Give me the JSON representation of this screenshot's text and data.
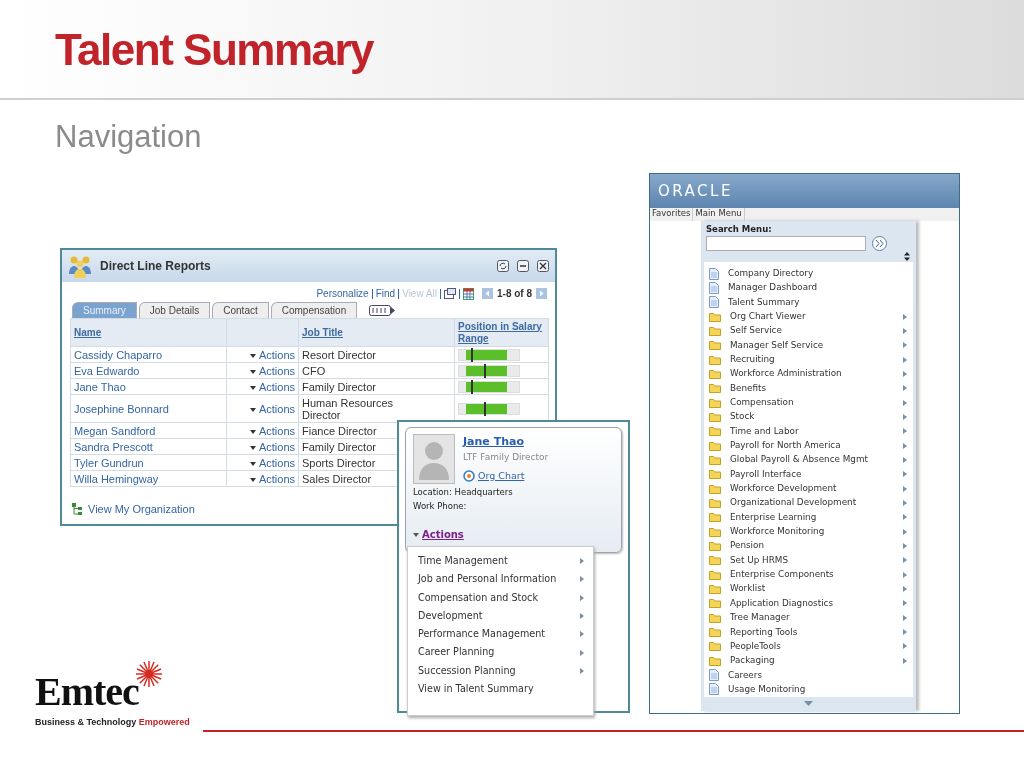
{
  "slide": {
    "title": "Talent Summary",
    "subtitle": "Navigation"
  },
  "direct_reports": {
    "title": "Direct Line Reports",
    "toolbar": [
      {
        "label": "Personalize",
        "disabled": false
      },
      {
        "label": "Find",
        "disabled": false
      },
      {
        "label": "View All",
        "disabled": true
      }
    ],
    "range": "1-8 of 8",
    "tabs": [
      {
        "label": "Summary",
        "selected": true
      },
      {
        "label": "Job Details",
        "selected": false
      },
      {
        "label": "Contact",
        "selected": false
      },
      {
        "label": "Compensation",
        "selected": false
      }
    ],
    "columns": [
      {
        "label": "Name"
      },
      {
        "label": "Job Title"
      },
      {
        "label": "Position in Salary Range"
      }
    ],
    "rows": [
      {
        "name": "Cassidy Chaparro",
        "actions": "Actions",
        "job_title": "Resort Director",
        "level": 0.2
      },
      {
        "name": "Eva Edwardo",
        "actions": "Actions",
        "job_title": "CFO",
        "level": 0.42
      },
      {
        "name": "Jane Thao",
        "actions": "Actions",
        "job_title": "Family Director",
        "level": 0.2
      },
      {
        "name": "Josephine Bonnard",
        "actions": "Actions",
        "job_title": "Human Resources Director",
        "level": 0.42
      },
      {
        "name": "Megan Sandford",
        "actions": "Actions",
        "job_title": "Fiance Director"
      },
      {
        "name": "Sandra Prescott",
        "actions": "Actions",
        "job_title": "Family Director"
      },
      {
        "name": "Tyler Gundrun",
        "actions": "Actions",
        "job_title": "Sports Director"
      },
      {
        "name": "Willa Hemingway",
        "actions": "Actions",
        "job_title": "Sales Director"
      }
    ],
    "footer_link": "View My Organization"
  },
  "person_card": {
    "name": "Jane Thao",
    "title": "LTF Family Director",
    "org_chart": "Org Chart",
    "location": "Location: Headquarters",
    "work_phone": "Work Phone:",
    "actions": "Actions",
    "menu": [
      {
        "label": "Time Management",
        "submenu": true
      },
      {
        "label": "Job and Personal Information",
        "submenu": true
      },
      {
        "label": "Compensation and Stock",
        "submenu": true
      },
      {
        "label": "Development",
        "submenu": true
      },
      {
        "label": "Performance Management",
        "submenu": true
      },
      {
        "label": "Career Planning",
        "submenu": true
      },
      {
        "label": "Succession Planning",
        "submenu": true
      },
      {
        "label": "View in Talent Summary",
        "submenu": false
      }
    ]
  },
  "oracle": {
    "logo": "ORACLE",
    "menu_bar": [
      "Favorites",
      "Main Menu"
    ],
    "search_label": "Search Menu:",
    "items": [
      {
        "label": "Company Directory",
        "kind": "page"
      },
      {
        "label": "Manager Dashboard",
        "kind": "page"
      },
      {
        "label": "Talent Summary",
        "kind": "page"
      },
      {
        "label": "Org Chart Viewer",
        "kind": "folder"
      },
      {
        "label": "Self Service",
        "kind": "folder"
      },
      {
        "label": "Manager Self Service",
        "kind": "folder"
      },
      {
        "label": "Recruiting",
        "kind": "folder"
      },
      {
        "label": "Workforce Administration",
        "kind": "folder"
      },
      {
        "label": "Benefits",
        "kind": "folder"
      },
      {
        "label": "Compensation",
        "kind": "folder"
      },
      {
        "label": "Stock",
        "kind": "folder"
      },
      {
        "label": "Time and Labor",
        "kind": "folder"
      },
      {
        "label": "Payroll for North America",
        "kind": "folder"
      },
      {
        "label": "Global Payroll & Absence Mgmt",
        "kind": "folder"
      },
      {
        "label": "Payroll Interface",
        "kind": "folder"
      },
      {
        "label": "Workforce Development",
        "kind": "folder"
      },
      {
        "label": "Organizational Development",
        "kind": "folder"
      },
      {
        "label": "Enterprise Learning",
        "kind": "folder"
      },
      {
        "label": "Workforce Monitoring",
        "kind": "folder"
      },
      {
        "label": "Pension",
        "kind": "folder"
      },
      {
        "label": "Set Up HRMS",
        "kind": "folder"
      },
      {
        "label": "Enterprise Components",
        "kind": "folder"
      },
      {
        "label": "Worklist",
        "kind": "folder"
      },
      {
        "label": "Application Diagnostics",
        "kind": "folder"
      },
      {
        "label": "Tree Manager",
        "kind": "folder"
      },
      {
        "label": "Reporting Tools",
        "kind": "folder"
      },
      {
        "label": "PeopleTools",
        "kind": "folder"
      },
      {
        "label": "Packaging",
        "kind": "folder"
      },
      {
        "label": "Careers",
        "kind": "page"
      },
      {
        "label": "Usage Monitoring",
        "kind": "page"
      }
    ]
  },
  "brand": {
    "name": "Emtec",
    "tagline": "Business & Technology",
    "tagline_accent": "Empowered"
  }
}
